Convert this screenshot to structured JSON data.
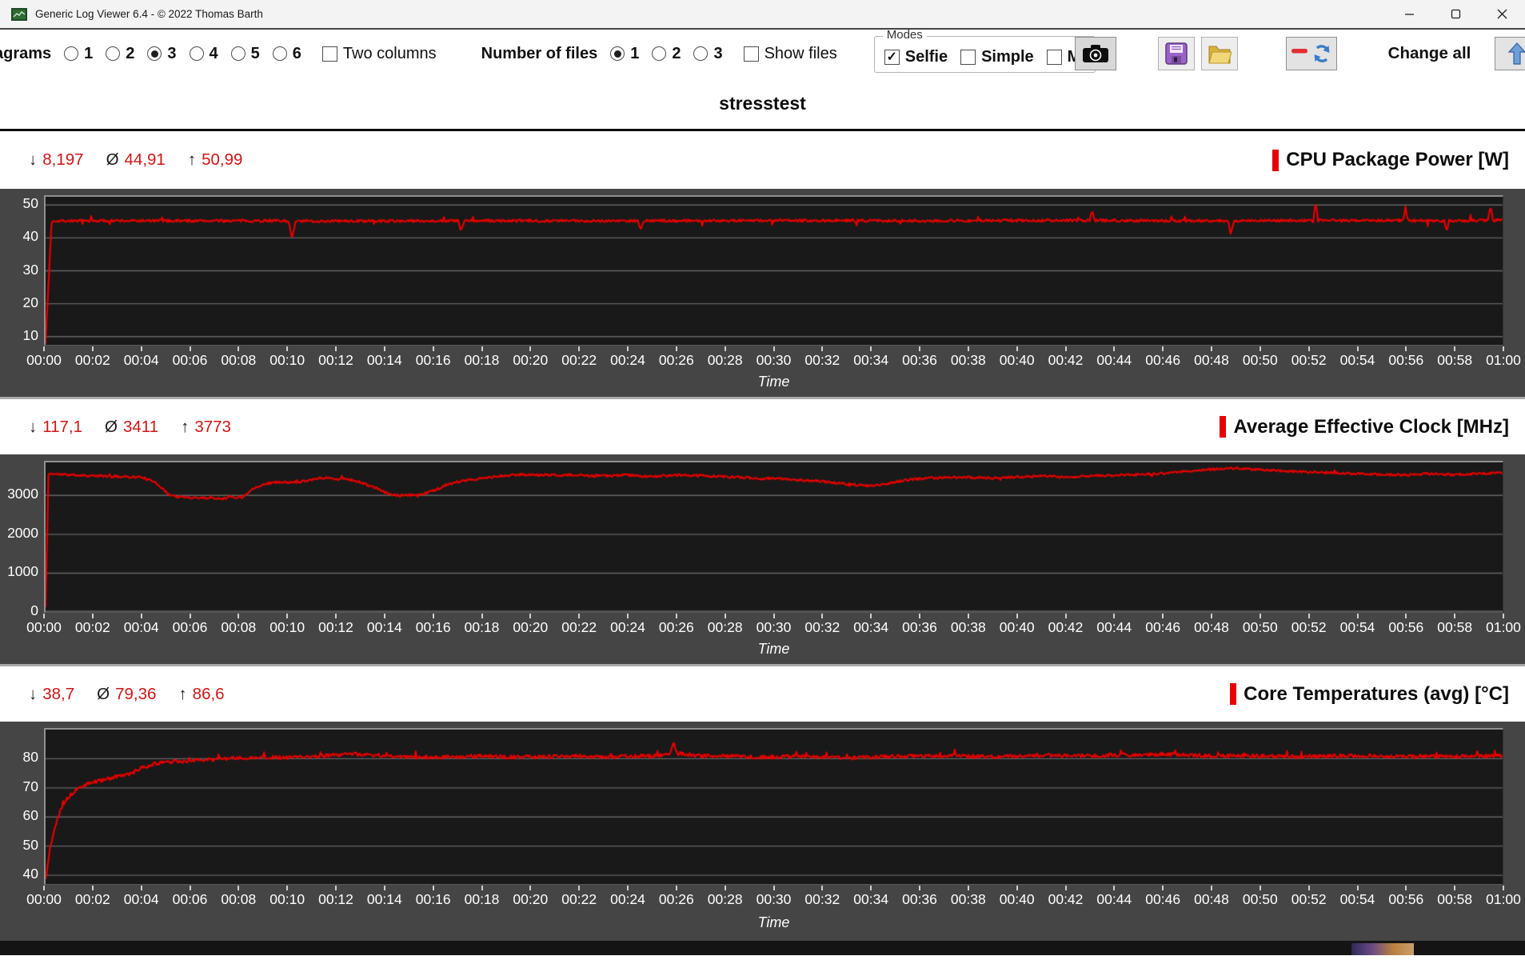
{
  "window": {
    "title": "Generic Log Viewer 6.4 - © 2022 Thomas Barth"
  },
  "toolbar": {
    "diagrams_label": "Diagrams",
    "diagram_options": [
      "1",
      "2",
      "3",
      "4",
      "5",
      "6"
    ],
    "diagram_selected": "3",
    "two_columns_label": "Two columns",
    "number_of_files_label": "Number of files",
    "file_options": [
      "1",
      "2",
      "3"
    ],
    "file_selected": "1",
    "show_files_label": "Show files",
    "modes": {
      "group_label": "Modes",
      "selfie_label": "Selfie",
      "selfie_checked": true,
      "simple_label": "Simple",
      "simple_checked": false,
      "third_label": "M",
      "third_checked": false
    },
    "change_all_label": "Change all"
  },
  "icons": {
    "check": "✓",
    "min_symbol": "↓",
    "avg_symbol": "Ø",
    "max_symbol": "↑"
  },
  "colors": {
    "accent_red": "#e60000",
    "stat_red": "#ce1515",
    "plot_bg": "#191919",
    "panel_gray": "#454545",
    "grid_gray": "#666666"
  },
  "heading": "stresstest",
  "time_axis": {
    "label": "Time",
    "ticks": [
      "00:00",
      "00:02",
      "00:04",
      "00:06",
      "00:08",
      "00:10",
      "00:12",
      "00:14",
      "00:16",
      "00:18",
      "00:20",
      "00:22",
      "00:24",
      "00:26",
      "00:28",
      "00:30",
      "00:32",
      "00:34",
      "00:36",
      "00:38",
      "00:40",
      "00:42",
      "00:44",
      "00:46",
      "00:48",
      "00:50",
      "00:52",
      "00:54",
      "00:56",
      "00:58",
      "01:00"
    ]
  },
  "chart_data": [
    {
      "type": "line",
      "title": "CPU Package Power [W]",
      "xlabel": "Time",
      "stats": {
        "min": "8,197",
        "avg": "44,91",
        "max": "50,99"
      },
      "yticks": [
        10,
        20,
        30,
        40,
        50
      ],
      "ylim": [
        7.5,
        52.5
      ],
      "xlim_minutes": [
        0,
        60
      ],
      "line_color": "#e60000",
      "seed": 7,
      "noise": 0.4,
      "spike": {
        "prob": 0.015,
        "amp": 1.8,
        "dir": "both"
      },
      "anchors": [
        [
          0,
          8.2
        ],
        [
          0.25,
          45.2
        ],
        [
          5,
          45.2
        ],
        [
          10,
          45.2
        ],
        [
          10.15,
          39.6
        ],
        [
          10.3,
          45.1
        ],
        [
          17,
          45.2
        ],
        [
          17.1,
          42.0
        ],
        [
          17.25,
          45.2
        ],
        [
          24.4,
          45.2
        ],
        [
          24.5,
          42.6
        ],
        [
          24.65,
          45.2
        ],
        [
          30,
          45.3
        ],
        [
          36,
          45.2
        ],
        [
          40,
          45.3
        ],
        [
          43,
          45.3
        ],
        [
          43.1,
          48.8
        ],
        [
          43.2,
          45.3
        ],
        [
          48.7,
          45.2
        ],
        [
          48.8,
          41.3
        ],
        [
          48.95,
          45.2
        ],
        [
          52.2,
          45.3
        ],
        [
          52.3,
          51.0
        ],
        [
          52.4,
          45.3
        ],
        [
          55.9,
          45.3
        ],
        [
          56.0,
          49.5
        ],
        [
          56.1,
          45.3
        ],
        [
          57.6,
          45.2
        ],
        [
          57.7,
          42.0
        ],
        [
          57.8,
          45.2
        ],
        [
          59.4,
          45.3
        ],
        [
          59.5,
          50.2
        ],
        [
          59.6,
          45.3
        ],
        [
          60,
          45.5
        ]
      ]
    },
    {
      "type": "line",
      "title": "Average Effective Clock [MHz]",
      "xlabel": "Time",
      "stats": {
        "min": "117,1",
        "avg": "3411",
        "max": "3773"
      },
      "yticks": [
        0,
        1000,
        2000,
        3000
      ],
      "ylim": [
        0,
        3850
      ],
      "xlim_minutes": [
        0,
        60
      ],
      "line_color": "#e60000",
      "seed": 11,
      "noise": 28,
      "spike": {
        "prob": 0.01,
        "amp": 70,
        "dir": "both"
      },
      "anchors": [
        [
          0,
          117
        ],
        [
          0.12,
          3560
        ],
        [
          0.5,
          3545
        ],
        [
          1,
          3530
        ],
        [
          2,
          3505
        ],
        [
          3,
          3485
        ],
        [
          4,
          3470
        ],
        [
          4.2,
          3400
        ],
        [
          4.5,
          3360
        ],
        [
          4.8,
          3180
        ],
        [
          5,
          3060
        ],
        [
          5.3,
          2980
        ],
        [
          5.6,
          2955
        ],
        [
          6,
          2945
        ],
        [
          6.5,
          2940
        ],
        [
          7,
          2930
        ],
        [
          7.4,
          2925
        ],
        [
          7.6,
          2975
        ],
        [
          7.8,
          2950
        ],
        [
          8.1,
          2955
        ],
        [
          8.3,
          3060
        ],
        [
          8.6,
          3200
        ],
        [
          9,
          3290
        ],
        [
          9.3,
          3330
        ],
        [
          9.6,
          3345
        ],
        [
          10,
          3330
        ],
        [
          10.4,
          3350
        ],
        [
          10.8,
          3390
        ],
        [
          11.2,
          3440
        ],
        [
          11.6,
          3455
        ],
        [
          12,
          3415
        ],
        [
          12.3,
          3440
        ],
        [
          12.6,
          3400
        ],
        [
          12.9,
          3350
        ],
        [
          13.2,
          3280
        ],
        [
          13.5,
          3220
        ],
        [
          13.8,
          3130
        ],
        [
          14.1,
          3050
        ],
        [
          14.4,
          3005
        ],
        [
          14.8,
          3000
        ],
        [
          15.2,
          3010
        ],
        [
          15.5,
          3035
        ],
        [
          15.8,
          3090
        ],
        [
          16.2,
          3180
        ],
        [
          16.6,
          3280
        ],
        [
          17,
          3350
        ],
        [
          17.5,
          3400
        ],
        [
          18,
          3440
        ],
        [
          18.5,
          3480
        ],
        [
          19,
          3510
        ],
        [
          19.5,
          3540
        ],
        [
          20,
          3530
        ],
        [
          21,
          3525
        ],
        [
          22,
          3520
        ],
        [
          22.5,
          3495
        ],
        [
          23,
          3505
        ],
        [
          24,
          3525
        ],
        [
          24.5,
          3500
        ],
        [
          25,
          3480
        ],
        [
          25.5,
          3510
        ],
        [
          26,
          3520
        ],
        [
          27,
          3510
        ],
        [
          28,
          3480
        ],
        [
          29,
          3455
        ],
        [
          29.5,
          3430
        ],
        [
          30,
          3440
        ],
        [
          31,
          3400
        ],
        [
          32,
          3360
        ],
        [
          32.5,
          3330
        ],
        [
          33,
          3290
        ],
        [
          33.5,
          3270
        ],
        [
          34,
          3245
        ],
        [
          34.3,
          3260
        ],
        [
          34.7,
          3310
        ],
        [
          35,
          3350
        ],
        [
          35.5,
          3400
        ],
        [
          36,
          3430
        ],
        [
          36.5,
          3450
        ],
        [
          37,
          3460
        ],
        [
          38,
          3465
        ],
        [
          39,
          3450
        ],
        [
          40,
          3475
        ],
        [
          41,
          3495
        ],
        [
          42,
          3470
        ],
        [
          43,
          3500
        ],
        [
          44,
          3520
        ],
        [
          45,
          3540
        ],
        [
          46,
          3560
        ],
        [
          46.5,
          3590
        ],
        [
          47,
          3620
        ],
        [
          47.5,
          3650
        ],
        [
          48,
          3670
        ],
        [
          48.5,
          3690
        ],
        [
          49,
          3700
        ],
        [
          49.5,
          3680
        ],
        [
          50,
          3660
        ],
        [
          51,
          3630
        ],
        [
          52,
          3600
        ],
        [
          53,
          3580
        ],
        [
          54,
          3560
        ],
        [
          55,
          3540
        ],
        [
          56,
          3525
        ],
        [
          56.5,
          3545
        ],
        [
          57,
          3560
        ],
        [
          57.5,
          3545
        ],
        [
          58,
          3535
        ],
        [
          58.5,
          3550
        ],
        [
          59,
          3560
        ],
        [
          59.5,
          3570
        ],
        [
          60,
          3580
        ]
      ]
    },
    {
      "type": "line",
      "title": "Core Temperatures (avg) [°C]",
      "xlabel": "Time",
      "stats": {
        "min": "38,7",
        "avg": "79,36",
        "max": "86,6"
      },
      "yticks": [
        40,
        50,
        60,
        70,
        80
      ],
      "ylim": [
        37,
        90
      ],
      "xlim_minutes": [
        0,
        60
      ],
      "line_color": "#e60000",
      "seed": 13,
      "noise": 0.6,
      "spike": {
        "prob": 0.025,
        "amp": 1.8,
        "dir": "up"
      },
      "anchors": [
        [
          0,
          38.7
        ],
        [
          0.2,
          50
        ],
        [
          0.5,
          60
        ],
        [
          0.8,
          65.5
        ],
        [
          1.2,
          69
        ],
        [
          1.6,
          71
        ],
        [
          2,
          72
        ],
        [
          2.5,
          73
        ],
        [
          3,
          74
        ],
        [
          3.5,
          74.8
        ],
        [
          4,
          77
        ],
        [
          4.5,
          78.3
        ],
        [
          5,
          78.8
        ],
        [
          5.5,
          79
        ],
        [
          6,
          79.3
        ],
        [
          7,
          79.8
        ],
        [
          8,
          80.3
        ],
        [
          9,
          80.4
        ],
        [
          10,
          80.4
        ],
        [
          11,
          80.8
        ],
        [
          12,
          81.3
        ],
        [
          12.5,
          81.8
        ],
        [
          13,
          81.4
        ],
        [
          14,
          81
        ],
        [
          15,
          80.6
        ],
        [
          16,
          80.6
        ],
        [
          17,
          80.6
        ],
        [
          18,
          80.9
        ],
        [
          19,
          80.6
        ],
        [
          20,
          80.6
        ],
        [
          21,
          80.7
        ],
        [
          22,
          80.9
        ],
        [
          23,
          80.6
        ],
        [
          24,
          80.9
        ],
        [
          25,
          81
        ],
        [
          25.7,
          81.5
        ],
        [
          25.85,
          85.6
        ],
        [
          26,
          81.8
        ],
        [
          27,
          81
        ],
        [
          28,
          81
        ],
        [
          29,
          80.6
        ],
        [
          30,
          80.6
        ],
        [
          31,
          80.9
        ],
        [
          32,
          80.6
        ],
        [
          33,
          80.2
        ],
        [
          34,
          80.6
        ],
        [
          35,
          80.9
        ],
        [
          36,
          80.9
        ],
        [
          37,
          81
        ],
        [
          38,
          80.9
        ],
        [
          39,
          80.6
        ],
        [
          40,
          80.9
        ],
        [
          41,
          81.2
        ],
        [
          42,
          81
        ],
        [
          43,
          81
        ],
        [
          44,
          81.3
        ],
        [
          45,
          81.3
        ],
        [
          46,
          81.6
        ],
        [
          47,
          81.3
        ],
        [
          48,
          81
        ],
        [
          49,
          81
        ],
        [
          50,
          81
        ],
        [
          51,
          80.7
        ],
        [
          52,
          80.7
        ],
        [
          53,
          81
        ],
        [
          54,
          81
        ],
        [
          55,
          81
        ],
        [
          56,
          80.7
        ],
        [
          57,
          81
        ],
        [
          58,
          80.7
        ],
        [
          59,
          81
        ],
        [
          60,
          81
        ]
      ]
    }
  ]
}
